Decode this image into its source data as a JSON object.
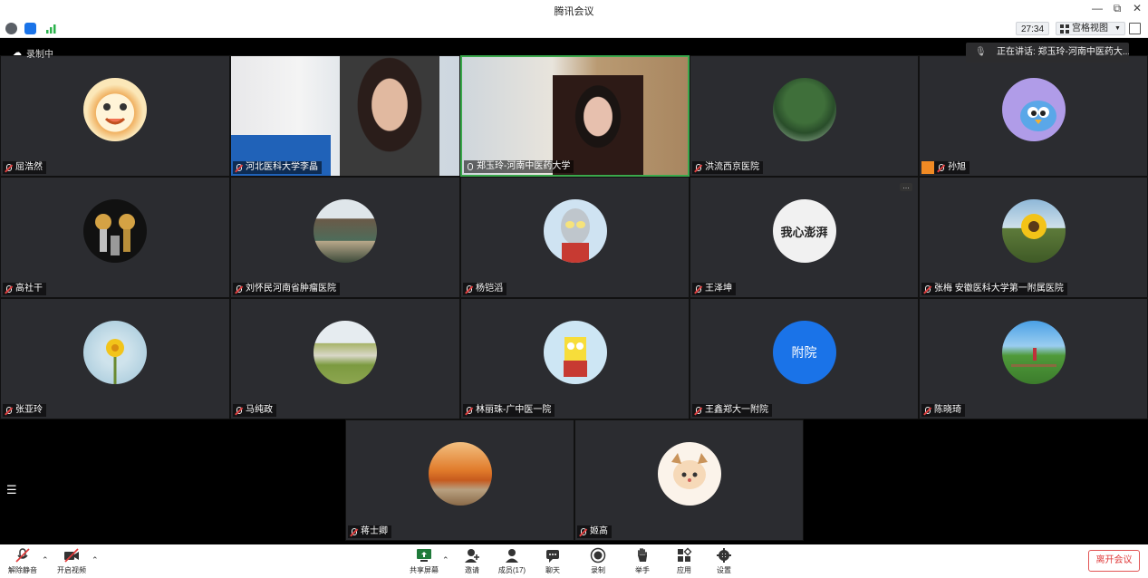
{
  "window": {
    "title": "腾讯会议"
  },
  "topbar": {
    "timer": "27:34",
    "view_label": "宫格视图"
  },
  "recording": {
    "label": "录制中"
  },
  "speaking": {
    "text": "正在讲话: 郑玉玲-河南中医药大..."
  },
  "participants": [
    {
      "name": "屈浩然",
      "avatar": "cartoon-tiger"
    },
    {
      "name": "河北医科大学李晶",
      "avatar": "video"
    },
    {
      "name": "郑玉玲-河南中医药大学",
      "avatar": "video",
      "mic_on": true
    },
    {
      "name": "洪流西京医院",
      "avatar": "tree"
    },
    {
      "name": "孙旭",
      "avatar": "blue-bird"
    },
    {
      "name": "高社干",
      "avatar": "trophies"
    },
    {
      "name": "刘怀民河南省肿瘤医院",
      "avatar": "river-town"
    },
    {
      "name": "杨铠滔",
      "avatar": "ultraman"
    },
    {
      "name": "王泽坤",
      "avatar": "calligraphy",
      "avatar_text": "我心澎湃"
    },
    {
      "name": "张梅 安徽医科大学第一附属医院",
      "avatar": "sunflower"
    },
    {
      "name": "张亚玲",
      "avatar": "yellow-flower"
    },
    {
      "name": "马纯政",
      "avatar": "landscape"
    },
    {
      "name": "林丽珠-广中医一院",
      "avatar": "spongebob"
    },
    {
      "name": "王鑫郑大一附院",
      "avatar": "text",
      "avatar_text": "附院"
    },
    {
      "name": "陈晓琦",
      "avatar": "meadow"
    },
    {
      "name": "蒋士卿",
      "avatar": "autumn"
    },
    {
      "name": "姬高",
      "avatar": "deer-girl"
    }
  ],
  "controls": {
    "unmute": "解除静音",
    "start_video": "开启视频",
    "share": "共享屏幕",
    "invite": "邀请",
    "members": "成员(17)",
    "chat": "聊天",
    "record": "录制",
    "raise_hand": "举手",
    "apps": "应用",
    "settings": "设置",
    "leave": "离开会议"
  },
  "colors": {
    "accent": "#1a73e8",
    "leave": "#e03b3b",
    "tile_bg": "#2b2c30"
  }
}
